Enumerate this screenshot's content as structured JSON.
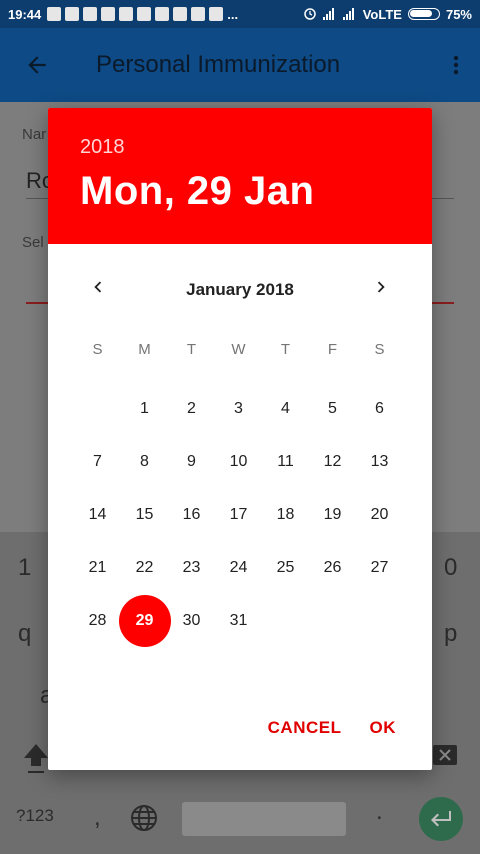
{
  "status": {
    "time": "19:44",
    "more": "...",
    "network": "VoLTE",
    "battery": "75%"
  },
  "app": {
    "title": "Personal Immunization"
  },
  "form": {
    "name_label": "Nar",
    "name_value": "Ro",
    "select_label": "Sel"
  },
  "keyboard": {
    "row1_left": "1",
    "row1_right": "0",
    "row2_left": "q",
    "row2_right": "p",
    "row3_left": "a",
    "sym": "?123",
    "comma": ",",
    "period": "."
  },
  "dialog": {
    "year": "2018",
    "selected_date": "Mon, 29 Jan",
    "month": "January 2018",
    "weekdays": [
      "S",
      "M",
      "T",
      "W",
      "T",
      "F",
      "S"
    ],
    "first_weekday": 1,
    "days_in_month": 31,
    "selected_day": 29,
    "cancel_label": "CANCEL",
    "ok_label": "OK"
  },
  "colors": {
    "accent": "#ff0000",
    "appbar": "#0e4a85",
    "statusbar": "#0d3d6e"
  }
}
